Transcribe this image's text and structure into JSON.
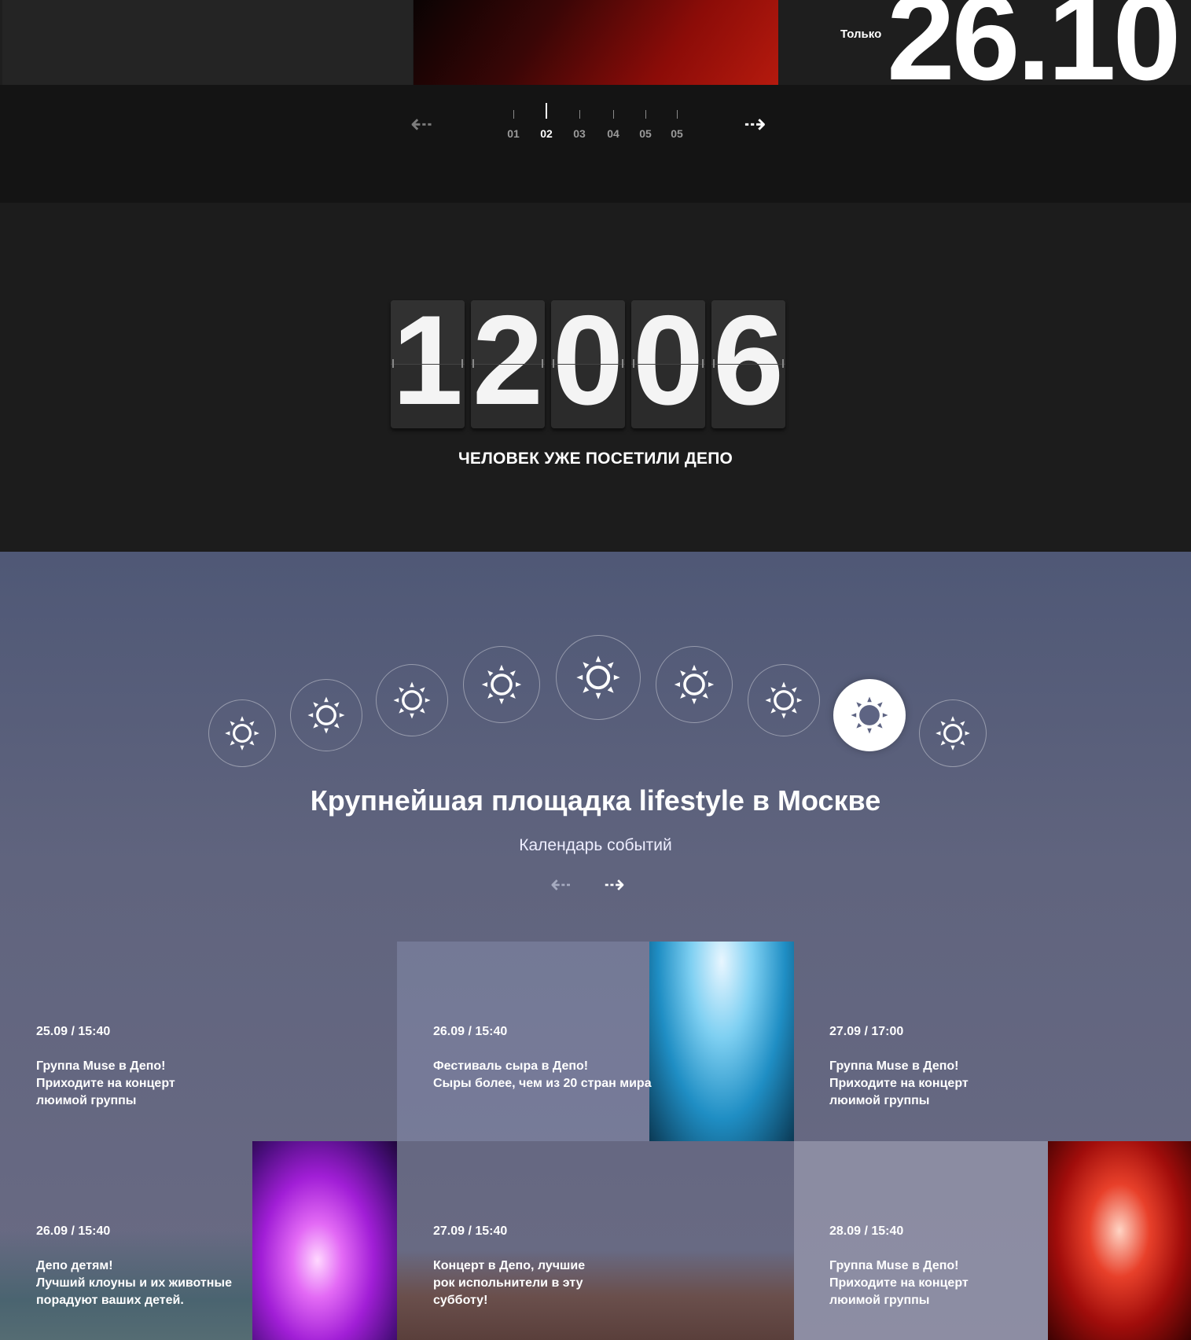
{
  "hero": {
    "only_label": "Только",
    "date": "26.10"
  },
  "slider": {
    "prev_icon": "arrow-left-icon",
    "next_icon": "arrow-right-icon",
    "pages": [
      "01",
      "02",
      "03",
      "04",
      "05",
      "05"
    ],
    "active_index": 1
  },
  "counter": {
    "digits": [
      "1",
      "2",
      "0",
      "0",
      "6"
    ],
    "caption": "ЧЕЛОВЕК УЖЕ ПОСЕТИЛИ ДЕПО"
  },
  "calendar": {
    "weather_icon": "sun-icon",
    "active_weather_index": 7,
    "title": "Крупнейшая площадка lifestyle в Москве",
    "subtitle": "Календарь событий",
    "events": [
      {
        "date": "25.09 / 15:40",
        "text": "Группа Muse в Депо!\nПриходите на концерт\nлюимой группы"
      },
      {
        "date": "26.09 / 15:40",
        "text": "Фестиваль сыра в Депо!\nСыры более, чем из 20 стран мира"
      },
      {
        "date": "27.09  / 17:00",
        "text": "Группа Muse в Депо!\nПриходите на концерт\nлюимой группы"
      },
      {
        "date": "26.09 / 15:40",
        "text": "Депо детям!\nЛучший клоуны и их животные\nпорадуют ваших детей."
      },
      {
        "date": "27.09 / 15:40",
        "text": "Концерт в Депо, лучшие\nрок испольнители в эту\nсубботу!"
      },
      {
        "date": "28.09  / 15:40",
        "text": "Группа Muse в Депо!\nПриходите на концерт\nлюимой группы"
      }
    ]
  },
  "colors": {
    "accent": "#ffffff",
    "bg_dark": "#1c1c1c",
    "calendar_bg": "#5a607c",
    "hero_red": "#8c0c08"
  }
}
